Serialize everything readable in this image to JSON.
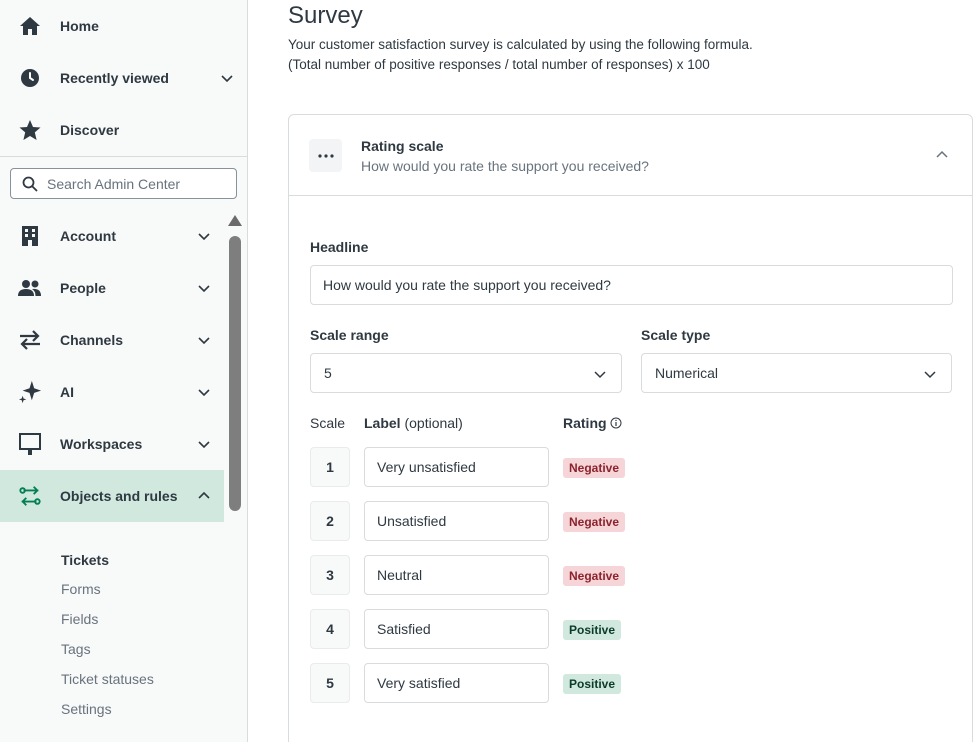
{
  "sidebar": {
    "top_items": [
      {
        "label": "Home",
        "icon": "home-icon"
      },
      {
        "label": "Recently viewed",
        "icon": "clock-icon"
      },
      {
        "label": "Discover",
        "icon": "star-icon"
      }
    ],
    "search_placeholder": "Search Admin Center",
    "sections": [
      {
        "label": "Account",
        "icon": "building-icon"
      },
      {
        "label": "People",
        "icon": "people-icon"
      },
      {
        "label": "Channels",
        "icon": "arrows-icon"
      },
      {
        "label": "AI",
        "icon": "sparkle-icon"
      },
      {
        "label": "Workspaces",
        "icon": "monitor-icon"
      },
      {
        "label": "Objects and rules",
        "icon": "objects-icon"
      }
    ],
    "sub_items": [
      "Tickets",
      "Forms",
      "Fields",
      "Tags",
      "Ticket statuses",
      "Settings"
    ],
    "accent_color": "#d1e8df"
  },
  "main": {
    "title": "Survey",
    "description_line1": "Your customer satisfaction survey is calculated by using the following formula.",
    "description_line2": "(Total number of positive responses / total number of responses) x 100",
    "card": {
      "title": "Rating scale",
      "subtitle": "How would you rate the support you received?",
      "headline_label": "Headline",
      "headline_value": "How would you rate the support you received?",
      "scale_range_label": "Scale range",
      "scale_range_value": "5",
      "scale_type_label": "Scale type",
      "scale_type_value": "Numerical",
      "col_scale": "Scale",
      "col_label": "Label",
      "col_label_optional": "(optional)",
      "col_rating": "Rating",
      "rows": [
        {
          "scale": "1",
          "label": "Very unsatisfied",
          "rating": "Negative"
        },
        {
          "scale": "2",
          "label": "Unsatisfied",
          "rating": "Negative"
        },
        {
          "scale": "3",
          "label": "Neutral",
          "rating": "Negative"
        },
        {
          "scale": "4",
          "label": "Satisfied",
          "rating": "Positive"
        },
        {
          "scale": "5",
          "label": "Very satisfied",
          "rating": "Positive"
        }
      ]
    }
  }
}
